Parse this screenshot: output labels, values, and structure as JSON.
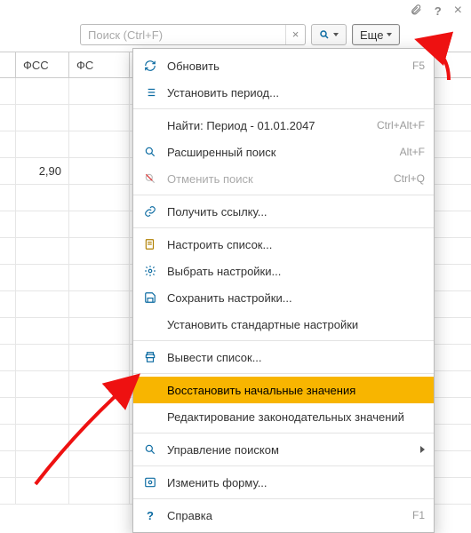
{
  "titlebar": {
    "attach_icon": "attach-icon",
    "help_icon": "help-icon",
    "close_icon": "close-icon"
  },
  "toolbar": {
    "search_placeholder": "Поиск (Ctrl+F)",
    "clear_label": "×",
    "more_label": "Еще"
  },
  "columns": {
    "c1": "ФСС",
    "c2": "ФС"
  },
  "cells": {
    "r3c1": "2,90"
  },
  "menu": {
    "refresh": {
      "label": "Обновить",
      "hotkey": "F5"
    },
    "set_period": {
      "label": "Установить период..."
    },
    "find": {
      "label": "Найти: Период - 01.01.2047",
      "hotkey": "Ctrl+Alt+F"
    },
    "adv_search": {
      "label": "Расширенный поиск",
      "hotkey": "Alt+F"
    },
    "cancel_search": {
      "label": "Отменить поиск",
      "hotkey": "Ctrl+Q"
    },
    "get_link": {
      "label": "Получить ссылку..."
    },
    "configure_list": {
      "label": "Настроить список..."
    },
    "choose_settings": {
      "label": "Выбрать настройки..."
    },
    "save_settings": {
      "label": "Сохранить настройки..."
    },
    "std_settings": {
      "label": "Установить стандартные настройки"
    },
    "print_list": {
      "label": "Вывести список..."
    },
    "restore_defaults": {
      "label": "Восстановить начальные значения"
    },
    "edit_legislative": {
      "label": "Редактирование законодательных значений"
    },
    "search_mgmt": {
      "label": "Управление поиском"
    },
    "change_form": {
      "label": "Изменить форму..."
    },
    "help": {
      "label": "Справка",
      "hotkey": "F1"
    }
  }
}
